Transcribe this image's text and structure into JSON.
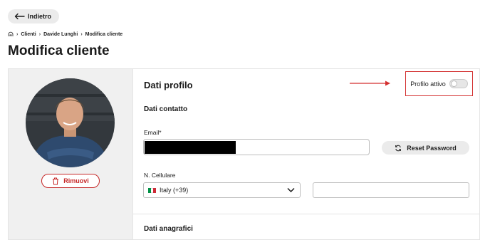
{
  "header": {
    "back_label": "Indietro",
    "breadcrumb": [
      "Clienti",
      "Davide Lunghi",
      "Modifica cliente"
    ],
    "page_title": "Modifica cliente"
  },
  "avatar": {
    "remove_label": "Rimuovi"
  },
  "profile": {
    "section_title": "Dati profilo",
    "active_toggle_label": "Profilo attivo",
    "active": false,
    "contact_title": "Dati contatto",
    "email_label": "Email*",
    "email_value": "",
    "reset_password_label": "Reset Password",
    "phone_label": "N. Cellulare",
    "country_value": "Italy (+39)",
    "phone_value": "",
    "anagraphic_title": "Dati anagrafici"
  },
  "colors": {
    "highlight_red": "#d32f2f",
    "danger": "#c62828",
    "flag_green": "#009246",
    "flag_white": "#ffffff",
    "flag_red": "#ce2b37"
  }
}
